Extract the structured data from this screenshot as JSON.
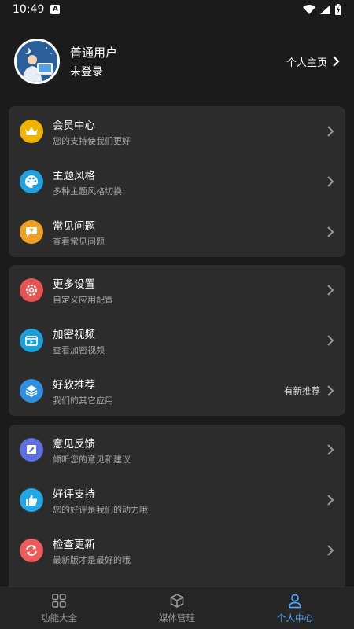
{
  "status_bar": {
    "time": "10:49",
    "notif_letter": "A"
  },
  "profile": {
    "name": "普通用户",
    "status": "未登录",
    "home_link": "个人主页"
  },
  "group1": [
    {
      "title": "会员中心",
      "sub": "您的支持使我们更好",
      "icon": "crown-icon",
      "color": "#f0b400"
    },
    {
      "title": "主题风格",
      "sub": "多种主题风格切换",
      "icon": "palette-icon",
      "color": "#1fa2e0"
    },
    {
      "title": "常见问题",
      "sub": "查看常见问题",
      "icon": "question-chat-icon",
      "color": "#f0a020"
    }
  ],
  "group2": [
    {
      "title": "更多设置",
      "sub": "自定义应用配置",
      "icon": "gear-icon",
      "color": "#e85454"
    },
    {
      "title": "加密视频",
      "sub": "查看加密视频",
      "icon": "video-icon",
      "color": "#1a9fd8"
    },
    {
      "title": "好软推荐",
      "sub": "我们的其它应用",
      "icon": "layers-icon",
      "color": "#2f8fe0",
      "badge": "有新推荐"
    }
  ],
  "group3": [
    {
      "title": "意见反馈",
      "sub": "倾听您的意见和建议",
      "icon": "edit-icon",
      "color": "#5b6fe0"
    },
    {
      "title": "好评支持",
      "sub": "您的好评是我们的动力哦",
      "icon": "thumbs-up-icon",
      "color": "#22a8e6"
    },
    {
      "title": "检查更新",
      "sub": "最新版才是最好的哦",
      "icon": "refresh-icon",
      "color": "#ef5a5a"
    }
  ],
  "nav": [
    {
      "label": "功能大全",
      "icon": "grid-icon"
    },
    {
      "label": "媒体管理",
      "icon": "cube-icon"
    },
    {
      "label": "个人中心",
      "icon": "person-icon",
      "active": true
    }
  ],
  "colors": {
    "accent": "#4da6ff",
    "card": "#2c2c2c",
    "background": "#1b1b1b"
  }
}
